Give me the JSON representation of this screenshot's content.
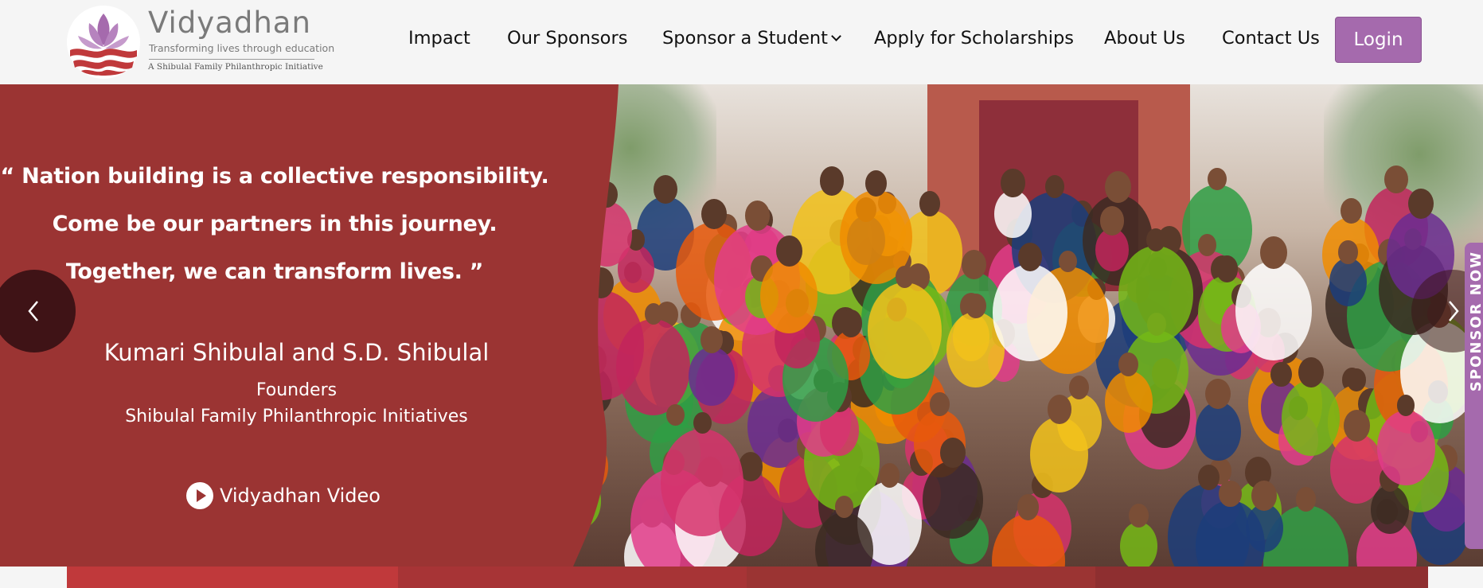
{
  "brand": {
    "name": "Vidyadhan",
    "tagline": "Transforming lives through education",
    "subline": "A Shibulal Family Philanthropic Initiative"
  },
  "nav": {
    "items": [
      {
        "label": "Impact"
      },
      {
        "label": "Our Sponsors"
      },
      {
        "label": "Sponsor a Student",
        "has_dropdown": true
      },
      {
        "label": "Apply for Scholarships"
      },
      {
        "label": "About Us"
      },
      {
        "label": "Contact Us"
      }
    ],
    "login_label": "Login"
  },
  "hero": {
    "quote_lines": [
      "“ Nation building is a collective responsibility.",
      "Come be our partners in this journey.",
      "Together, we can transform lives. ”"
    ],
    "founder_a": "Kumari Shibulal",
    "founder_joiner": "and",
    "founder_b": "S.D. Shibulal",
    "role": "Founders",
    "organization": "Shibulal Family Philanthropic Initiatives",
    "video_label": "Vidyadhan Video",
    "prev_icon": "chevron-left-icon",
    "next_icon": "chevron-right-icon"
  },
  "side_tab": {
    "label": "SPONSOR NOW"
  },
  "colors": {
    "hero_red": "#9b3433",
    "accent_purple": "#a56aad",
    "header_bg": "#f5f5f5",
    "nav_text": "#111111"
  }
}
